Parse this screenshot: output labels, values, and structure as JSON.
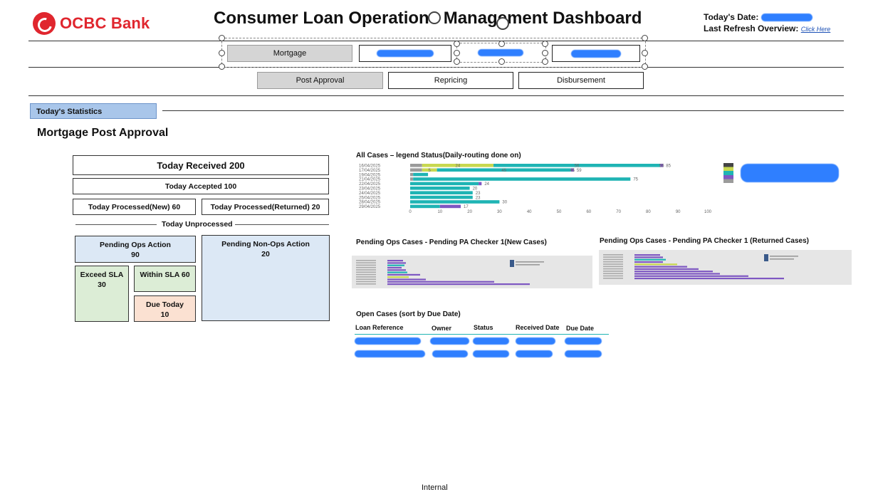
{
  "header": {
    "logo_text": "OCBC Bank",
    "title": "Consumer Loan Operations Management Dashboard",
    "date_label": "Today's Date:",
    "refresh_label": "Last Refresh Overview:",
    "refresh_link": "Click Here"
  },
  "product_tabs": [
    {
      "label": "Mortgage",
      "selected": true
    },
    {
      "label": "",
      "redacted": true
    },
    {
      "label": "",
      "redacted": true
    },
    {
      "label": "",
      "redacted": true
    }
  ],
  "stage_tabs": [
    {
      "label": "Post Approval",
      "selected": true
    },
    {
      "label": "Repricing"
    },
    {
      "label": "Disbursement"
    }
  ],
  "section_tab": "Today's Statistics",
  "section_title": "Mortgage Post Approval",
  "stats": {
    "received": "Today Received 200",
    "accepted": "Today Accepted 100",
    "processed_new": "Today Processed(New) 60",
    "processed_returned": "Today Processed(Returned) 20",
    "unprocessed": "Today Unprocessed",
    "pending_ops_label": "Pending Ops Action",
    "pending_ops_value": "90",
    "pending_nonops_label": "Pending Non-Ops Action",
    "pending_nonops_value": "20",
    "exceed_sla_label": "Exceed SLA",
    "exceed_sla_value": "30",
    "within_sla": "Within SLA 60",
    "due_today_label": "Due Today",
    "due_today_value": "10"
  },
  "colors": {
    "tab_selected": "#d5d5d5",
    "stat_tab": "#a9c6ea",
    "pending_blue": "#dce8f5",
    "sla_green": "#dcedd6",
    "due_orange": "#fbe1d2",
    "teal": "#1fb4b4",
    "lime": "#c8d850",
    "redact": "#2f7fff"
  },
  "chart_data": {
    "type": "bar",
    "title": "All Cases – legend Status(Daily-routing done on)",
    "categories": [
      "16/04/2025",
      "17/04/2025",
      "19/04/2025",
      "21/04/2025",
      "22/04/2025",
      "23/04/2025",
      "24/04/2025",
      "25/04/2025",
      "28/04/2025",
      "29/04/2025"
    ],
    "series": [
      {
        "color": "#9b9b9b",
        "values": [
          4,
          4,
          1,
          1,
          0,
          0,
          0,
          0,
          0,
          0
        ]
      },
      {
        "color": "#c8d850",
        "values": [
          24,
          5,
          0,
          0,
          0,
          0,
          0,
          0,
          0,
          0
        ]
      },
      {
        "color": "#1fb4b4",
        "values": [
          56,
          45,
          5,
          73,
          23,
          20,
          21,
          21,
          30,
          10
        ]
      },
      {
        "color": "#7e57c2",
        "values": [
          1,
          1,
          0,
          0,
          1,
          0,
          0,
          0,
          0,
          7
        ]
      }
    ],
    "data_labels": [
      "85",
      "59",
      "",
      "75",
      "24",
      "20",
      "23",
      "23",
      "30",
      "17"
    ],
    "segment_labels": [
      [
        "4",
        "24",
        "56"
      ],
      [
        "4",
        "5",
        "45"
      ],
      [],
      [
        "",
        "73"
      ],
      [
        "23"
      ],
      [
        "16"
      ],
      [
        "21"
      ],
      [
        "21"
      ],
      [],
      [
        "12"
      ]
    ],
    "xticks": [
      "0",
      "10",
      "20",
      "30",
      "40",
      "50",
      "60",
      "70",
      "80",
      "90",
      "100"
    ],
    "xlim": [
      0,
      100
    ]
  },
  "mini_chart_new": {
    "title": "Pending Ops Cases - Pending PA Checker 1(New Cases)"
  },
  "mini_chart_returned": {
    "title": "Pending Ops Cases - Pending PA Checker 1 (Returned Cases)"
  },
  "open_cases": {
    "title": "Open Cases (sort by Due Date)",
    "columns": [
      "Loan Reference",
      "Owner",
      "Status",
      "Received Date",
      "Due Date"
    ]
  },
  "footer": {
    "classification": "Internal"
  }
}
